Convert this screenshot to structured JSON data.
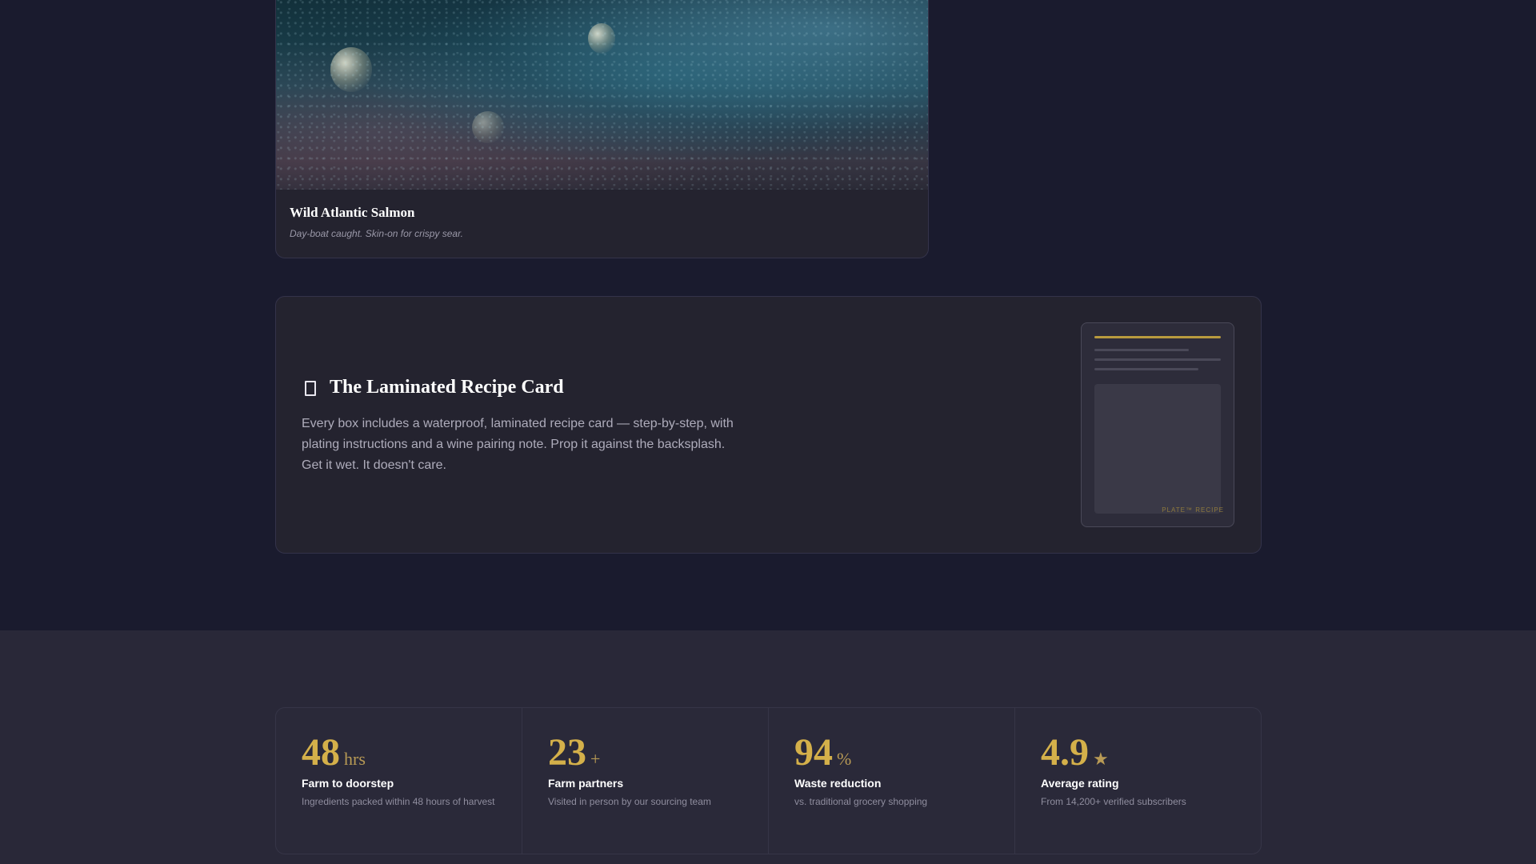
{
  "product": {
    "title": "Wild Atlantic Salmon",
    "description": "Day-boat caught. Skin-on for crispy sear."
  },
  "feature": {
    "icon": "book-icon",
    "title": "The Laminated Recipe Card",
    "text": "Every box includes a waterproof, laminated recipe card — step-by-step, with plating instructions and a wine pairing note. Prop it against the backsplash. Get it wet. It doesn't care.",
    "card_brand": "PLATE™ RECIPE"
  },
  "stats": [
    {
      "value": "48",
      "unit": "hrs",
      "label": "Farm to doorstep",
      "sub": "Ingredients packed within 48 hours of harvest"
    },
    {
      "value": "23",
      "unit": "+",
      "label": "Farm partners",
      "sub": "Visited in person by our sourcing team"
    },
    {
      "value": "94",
      "unit": "%",
      "label": "Waste reduction",
      "sub": "vs. traditional grocery shopping"
    },
    {
      "value": "4.9",
      "unit": "★",
      "label": "Average rating",
      "sub": "From 14,200+ verified subscribers"
    }
  ],
  "colors": {
    "background": "#1a1b2e",
    "card": "#24232f",
    "accent_gold": "#d4b04a"
  }
}
